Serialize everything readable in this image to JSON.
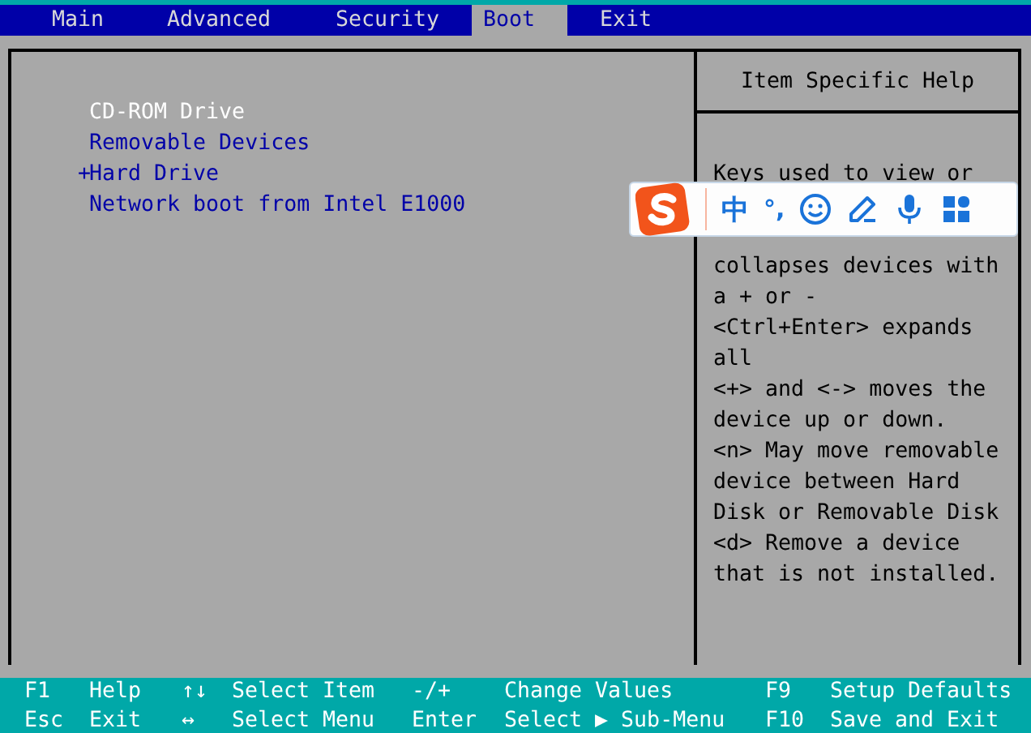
{
  "menu_bar": {
    "tabs": [
      {
        "label": "Main",
        "selected": false
      },
      {
        "label": "Advanced",
        "selected": false
      },
      {
        "label": "Security",
        "selected": false
      },
      {
        "label": "Boot",
        "selected": true
      },
      {
        "label": "Exit",
        "selected": false
      }
    ]
  },
  "boot_list": {
    "items": [
      {
        "label": "CD-ROM Drive",
        "selected": true,
        "marker": ""
      },
      {
        "label": "Removable Devices",
        "selected": false,
        "marker": ""
      },
      {
        "label": "Hard Drive",
        "selected": false,
        "marker": "+"
      },
      {
        "label": "Network boot from Intel E1000",
        "selected": false,
        "marker": ""
      }
    ]
  },
  "help_panel": {
    "title": "Item Specific Help",
    "lines_before_overlay": [
      "Keys used to view or"
    ],
    "lines_after_overlay": [
      "collapses devices with",
      "a + or -",
      "<Ctrl+Enter> expands",
      "all",
      "<+> and <-> moves the",
      "device up or down.",
      "<n> May move removable",
      "device between Hard",
      "Disk or Removable Disk",
      "<d> Remove a device",
      "that is not installed."
    ]
  },
  "ime_toolbar": {
    "mode": "中",
    "punctuation": "°,"
  },
  "key_legend": {
    "rows": [
      [
        "F1",
        "Help",
        "↑↓",
        "Select Item",
        "-/+",
        "Change Values",
        "F9",
        "Setup Defaults"
      ],
      [
        "Esc",
        "Exit",
        "↔",
        "Select Menu",
        "Enter",
        "Select ▶ Sub-Menu",
        "F10",
        "Save and Exit"
      ]
    ]
  }
}
